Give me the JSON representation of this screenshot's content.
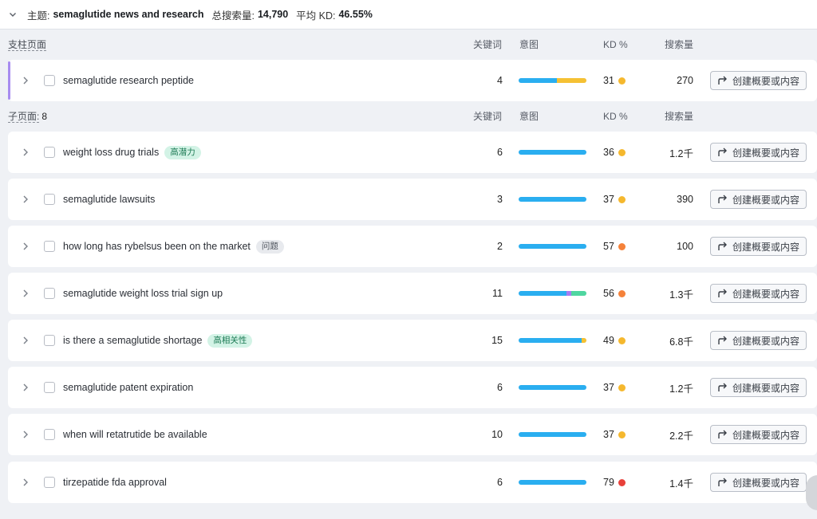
{
  "topic": {
    "label": "主题:",
    "name": "semaglutide news and research",
    "total_volume_label": "总搜索量:",
    "total_volume": "14,790",
    "avg_kd_label": "平均 KD:",
    "avg_kd": "46.55%"
  },
  "pillar_section": {
    "title": "支柱页面",
    "col_keywords": "关键词",
    "col_intent": "意图",
    "col_kd": "KD %",
    "col_volume": "搜索量"
  },
  "pillar_row": {
    "keyword": "semaglutide research peptide",
    "keywords_count": "4",
    "kd": "31",
    "kd_color": "#f5b82e",
    "volume": "270",
    "intent": [
      {
        "color": "#2aaef0",
        "fraction": 0.56
      },
      {
        "color": "#f5c133",
        "fraction": 0.44
      }
    ],
    "action_label": "创建概要或内容"
  },
  "sub_section": {
    "title": "子页面:",
    "count": "8",
    "col_keywords": "关键词",
    "col_intent": "意图",
    "col_kd": "KD %",
    "col_volume": "搜索量"
  },
  "sub_rows": [
    {
      "keyword": "weight loss drug trials",
      "badge": "高潜力",
      "badge_style": "green",
      "keywords_count": "6",
      "kd": "36",
      "kd_color": "#f5b82e",
      "volume": "1.2千",
      "intent": [
        {
          "color": "#2aaef0",
          "fraction": 1.0
        }
      ],
      "action_label": "创建概要或内容"
    },
    {
      "keyword": "semaglutide lawsuits",
      "badge": "",
      "badge_style": "",
      "keywords_count": "3",
      "kd": "37",
      "kd_color": "#f5b82e",
      "volume": "390",
      "intent": [
        {
          "color": "#2aaef0",
          "fraction": 1.0
        }
      ],
      "action_label": "创建概要或内容"
    },
    {
      "keyword": "how long has rybelsus been on the market",
      "badge": "问题",
      "badge_style": "gray",
      "keywords_count": "2",
      "kd": "57",
      "kd_color": "#f5823a",
      "volume": "100",
      "intent": [
        {
          "color": "#2aaef0",
          "fraction": 1.0
        }
      ],
      "action_label": "创建概要或内容"
    },
    {
      "keyword": "semaglutide weight loss trial sign up",
      "badge": "",
      "badge_style": "",
      "keywords_count": "11",
      "kd": "56",
      "kd_color": "#f5823a",
      "volume": "1.3千",
      "intent": [
        {
          "color": "#2aaef0",
          "fraction": 0.71
        },
        {
          "color": "#a77cf2",
          "fraction": 0.07
        },
        {
          "color": "#4fd6a0",
          "fraction": 0.22
        }
      ],
      "action_label": "创建概要或内容"
    },
    {
      "keyword": "is there a semaglutide shortage",
      "badge": "高相关性",
      "badge_style": "green",
      "keywords_count": "15",
      "kd": "49",
      "kd_color": "#f5b82e",
      "volume": "6.8千",
      "intent": [
        {
          "color": "#2aaef0",
          "fraction": 0.93
        },
        {
          "color": "#f5c133",
          "fraction": 0.07
        }
      ],
      "action_label": "创建概要或内容"
    },
    {
      "keyword": "semaglutide patent expiration",
      "badge": "",
      "badge_style": "",
      "keywords_count": "6",
      "kd": "37",
      "kd_color": "#f5b82e",
      "volume": "1.2千",
      "intent": [
        {
          "color": "#2aaef0",
          "fraction": 1.0
        }
      ],
      "action_label": "创建概要或内容"
    },
    {
      "keyword": "when will retatrutide be available",
      "badge": "",
      "badge_style": "",
      "keywords_count": "10",
      "kd": "37",
      "kd_color": "#f5b82e",
      "volume": "2.2千",
      "intent": [
        {
          "color": "#2aaef0",
          "fraction": 1.0
        }
      ],
      "action_label": "创建概要或内容"
    },
    {
      "keyword": "tirzepatide fda approval",
      "badge": "",
      "badge_style": "",
      "keywords_count": "6",
      "kd": "79",
      "kd_color": "#e8413a",
      "volume": "1.4千",
      "intent": [
        {
          "color": "#2aaef0",
          "fraction": 1.0
        }
      ],
      "action_label": "创建概要或内容"
    }
  ]
}
